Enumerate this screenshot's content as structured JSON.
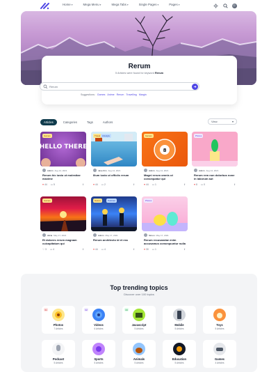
{
  "nav": {
    "menu": [
      {
        "label": "Home"
      },
      {
        "label": "Mega Menu"
      },
      {
        "label": "Mega Tabs"
      },
      {
        "label": "Single Pages"
      },
      {
        "label": "Pages"
      }
    ]
  },
  "search": {
    "title": "Rerum",
    "sub_prefix": "5 Articles were found for keyword",
    "sub_keyword": "Rerum",
    "placeholder": "Rerum",
    "suggest_label": "Suggestions:",
    "suggestions": [
      "Games",
      "Anime",
      "Rerum",
      "Travelling",
      "Margin"
    ]
  },
  "tabs": [
    {
      "label": "Articles",
      "active": true
    },
    {
      "label": "Categories",
      "active": false
    },
    {
      "label": "Tags",
      "active": false
    },
    {
      "label": "Authors",
      "active": false
    }
  ],
  "sort": {
    "value": "View"
  },
  "cards": [
    {
      "badge": "Games",
      "badge2": "",
      "author": "Admin",
      "date": "Aug 14, 2021",
      "title": "Rerum hic iusto ut molestiae maxime",
      "likes": "44",
      "comments": "5",
      "img_text": "HELLO THERE"
    },
    {
      "badge": "Travel",
      "badge2": "Lifestyle",
      "author": "Jane Kim",
      "date": "Aug 14, 2021",
      "title": "Illum iusto ut officiis rerum",
      "likes": "44",
      "comments": "2",
      "img_text": ""
    },
    {
      "badge": "Games",
      "badge2": "",
      "author": "Admin",
      "date": "Aug 14, 2021",
      "title": "Magni rerum omnis ut consequatur qui",
      "likes": "44",
      "comments": "1",
      "img_text": ""
    },
    {
      "badge": "Photos",
      "badge2": "",
      "author": "Admin",
      "date": "Aug 14, 2021",
      "title": "Rerum rem non dolorbus none in laborum aut",
      "likes": "8",
      "comments": "0",
      "img_text": ""
    },
    {
      "badge": "Games",
      "badge2": "",
      "author": "Alicia",
      "date": "May 17, 2021",
      "title": "Et dolores rerum magnam cuicapitatum qui",
      "likes": "3",
      "comments": "4",
      "img_text": ""
    },
    {
      "badge": "Nature",
      "badge2": "Podcast",
      "author": "Admin",
      "date": "May 17, 2021",
      "title": "Rerum architecto id et ess",
      "likes": "44",
      "comments": "4",
      "img_text": ""
    },
    {
      "badge": "Photos",
      "badge2": "",
      "author": "Simon",
      "date": "May 17, 2021",
      "title": "Rerum recusandae enim accusamus consequuntur nulla",
      "likes": "30",
      "comments": "1",
      "img_text": ""
    }
  ],
  "trending": {
    "title": "Top trending topics",
    "sub": "Discover over 100 topics",
    "topics": [
      {
        "num": "01",
        "name": "Photos",
        "count": "7 Articles",
        "numbg": "#fee2e2",
        "numfg": "#b91c1c"
      },
      {
        "num": "02",
        "name": "Videos",
        "count": "6 Articles",
        "numbg": "#ede9fe",
        "numfg": "#6d28d9"
      },
      {
        "num": "03",
        "name": "Javascript",
        "count": "5 Articles",
        "numbg": "#dcfce7",
        "numfg": "#15803d"
      },
      {
        "num": "",
        "name": "Mobile",
        "count": "5 Articles",
        "numbg": "#fff",
        "numfg": "#fff"
      },
      {
        "num": "",
        "name": "Toys",
        "count": "5 Articles",
        "numbg": "#fff",
        "numfg": "#fff"
      },
      {
        "num": "",
        "name": "Podcast",
        "count": "5 Articles",
        "numbg": "#fff",
        "numfg": "#fff"
      },
      {
        "num": "",
        "name": "Sports",
        "count": "5 Articles",
        "numbg": "#fff",
        "numfg": "#fff"
      },
      {
        "num": "",
        "name": "Animals",
        "count": "5 Articles",
        "numbg": "#fff",
        "numfg": "#fff"
      },
      {
        "num": "",
        "name": "Education",
        "count": "5 Articles",
        "numbg": "#fff",
        "numfg": "#fff"
      },
      {
        "num": "",
        "name": "Games",
        "count": "4 Articles",
        "numbg": "#fff",
        "numfg": "#fff"
      }
    ]
  },
  "colors": {
    "accent": "#4f46e5",
    "tab_active": "#0f3b4c",
    "like": "#ef4444"
  }
}
